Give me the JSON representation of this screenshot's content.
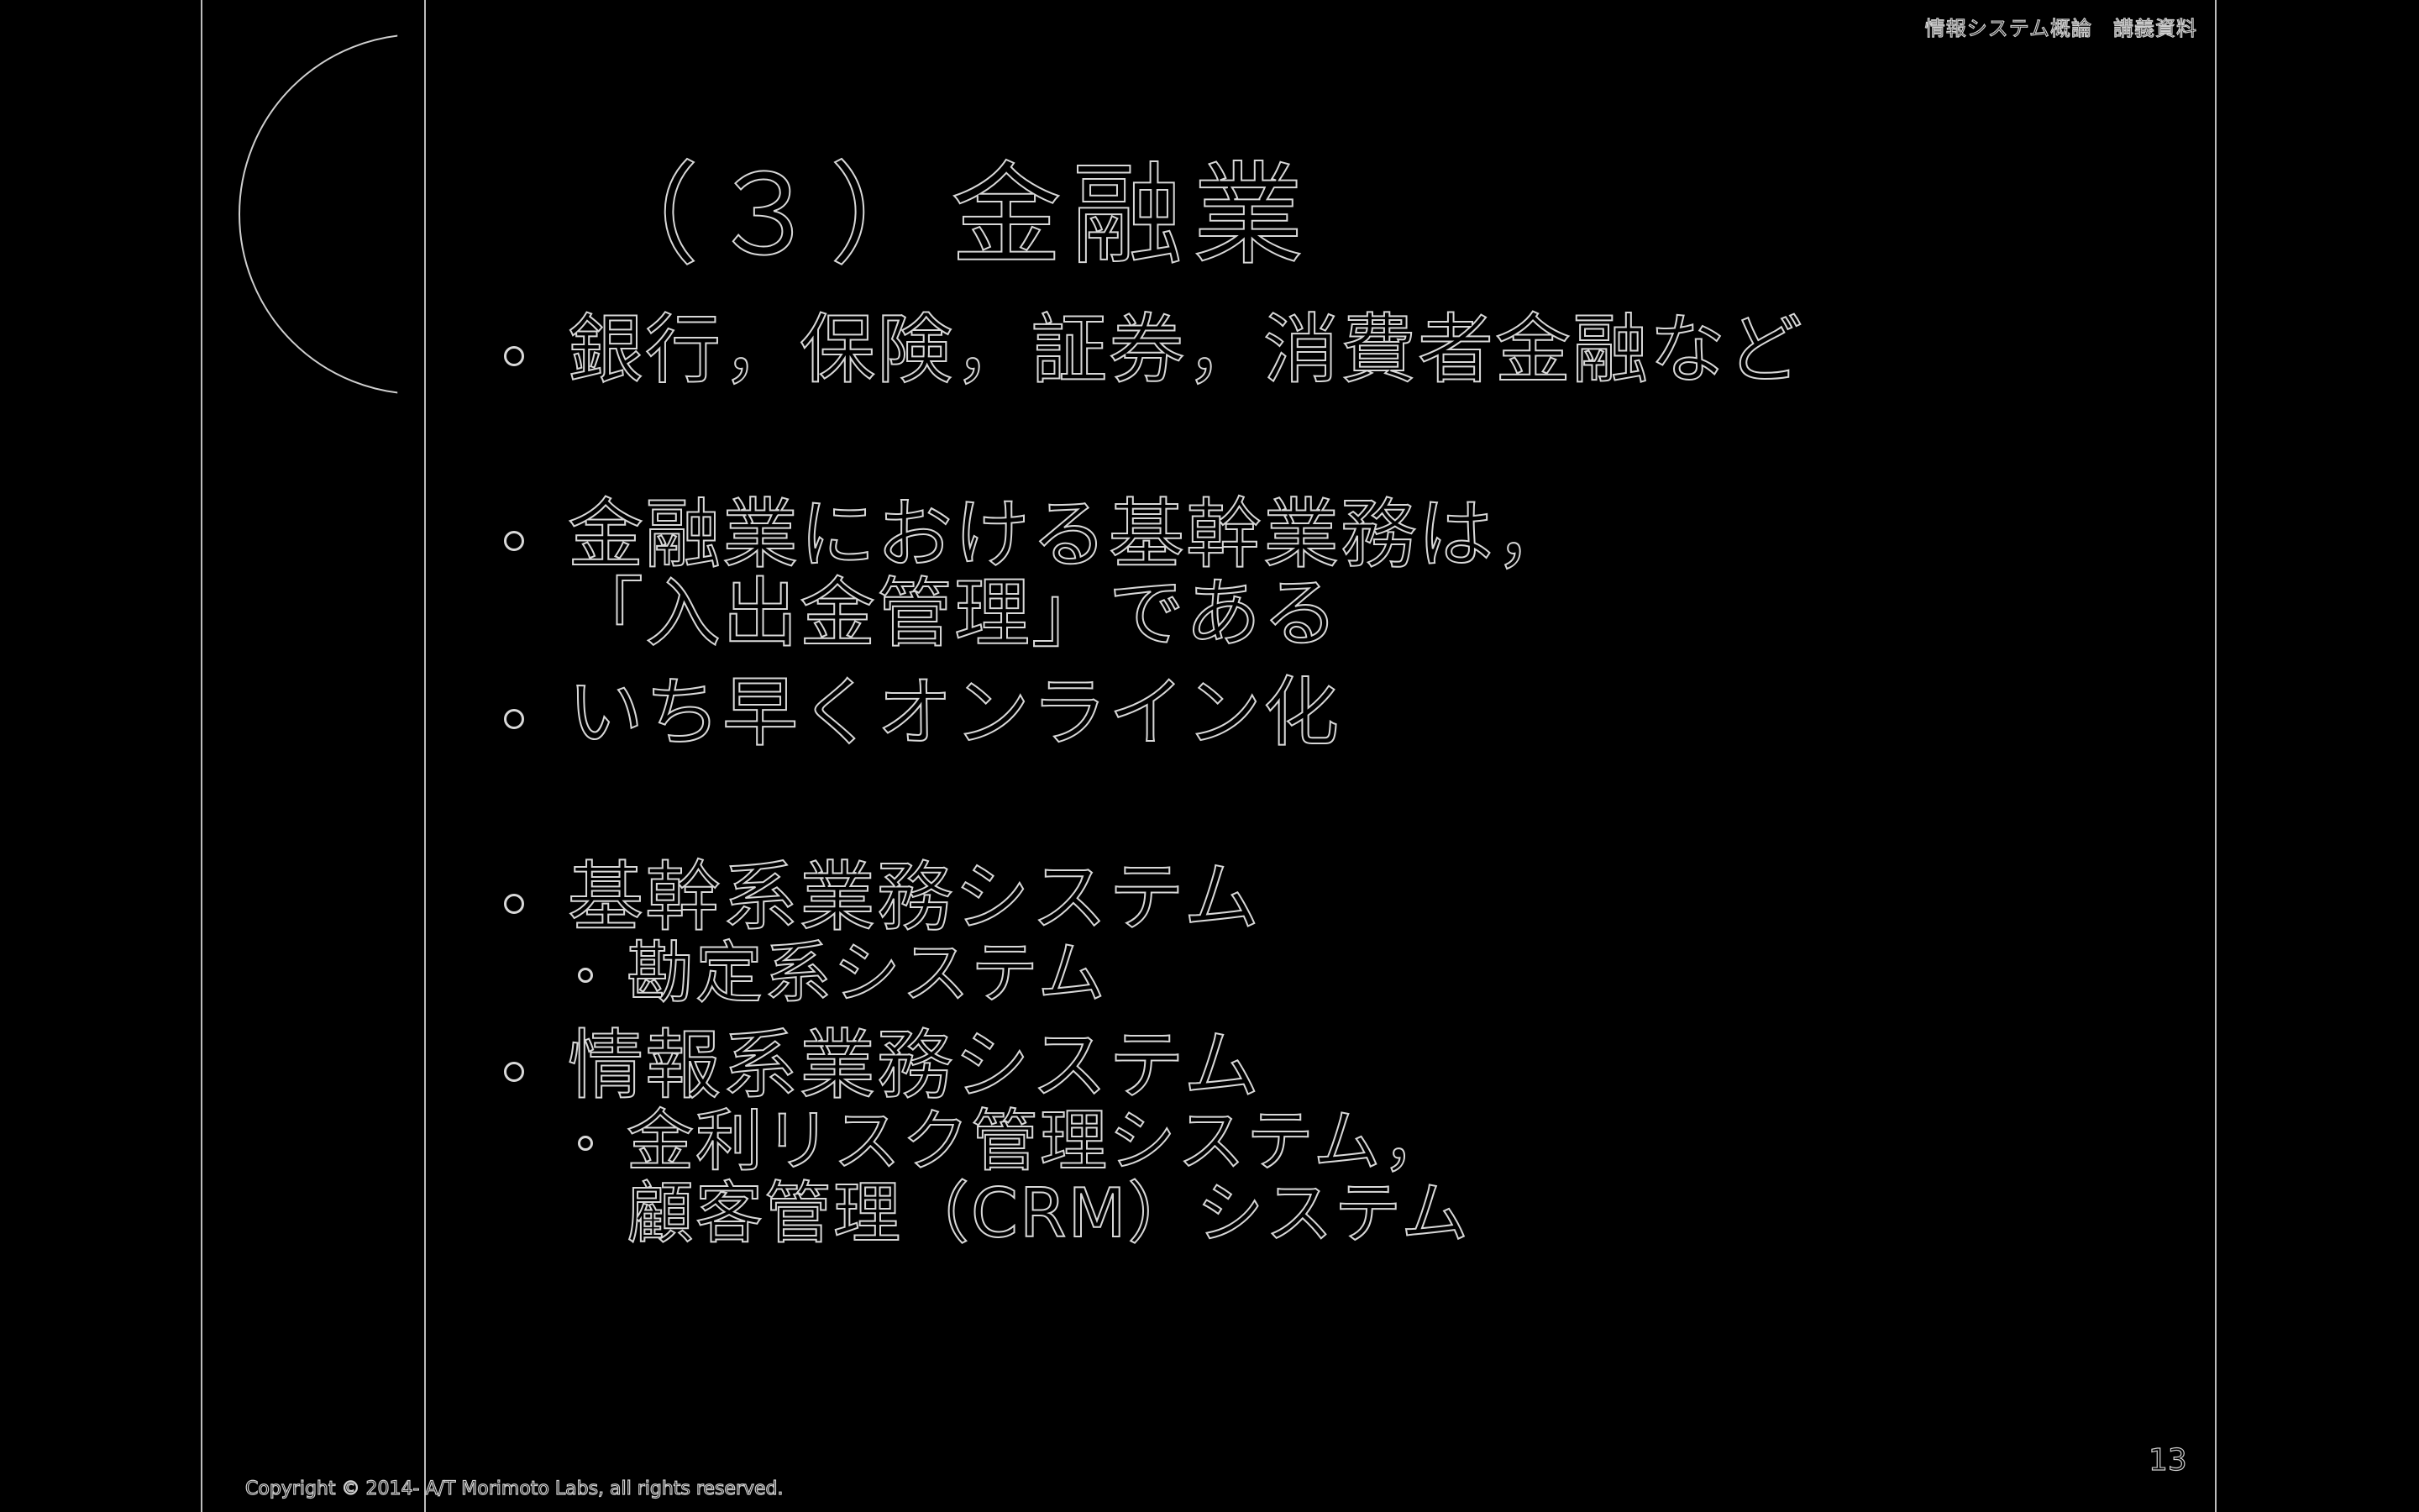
{
  "header": {
    "course_label": "情報システム概論　講義資料"
  },
  "slide": {
    "title": "（３）金融業",
    "bullets": [
      {
        "text": "銀行，保険，証券，消費者金融など"
      },
      {
        "lines": [
          "金融業における基幹業務は，",
          "「入出金管理」である"
        ]
      },
      {
        "text": "いち早くオンライン化"
      },
      {
        "text": "基幹系業務システム",
        "sub": [
          {
            "text": "勘定系システム"
          }
        ]
      },
      {
        "text": "情報系業務システム",
        "sub": [
          {
            "lines": [
              "金利リスク管理システム，",
              "顧客管理（CRM）システム"
            ]
          }
        ]
      }
    ]
  },
  "footer": {
    "copyright": "Copyright © 2014- A/T Morimoto Labs, all rights reserved.",
    "page_number": "13"
  }
}
